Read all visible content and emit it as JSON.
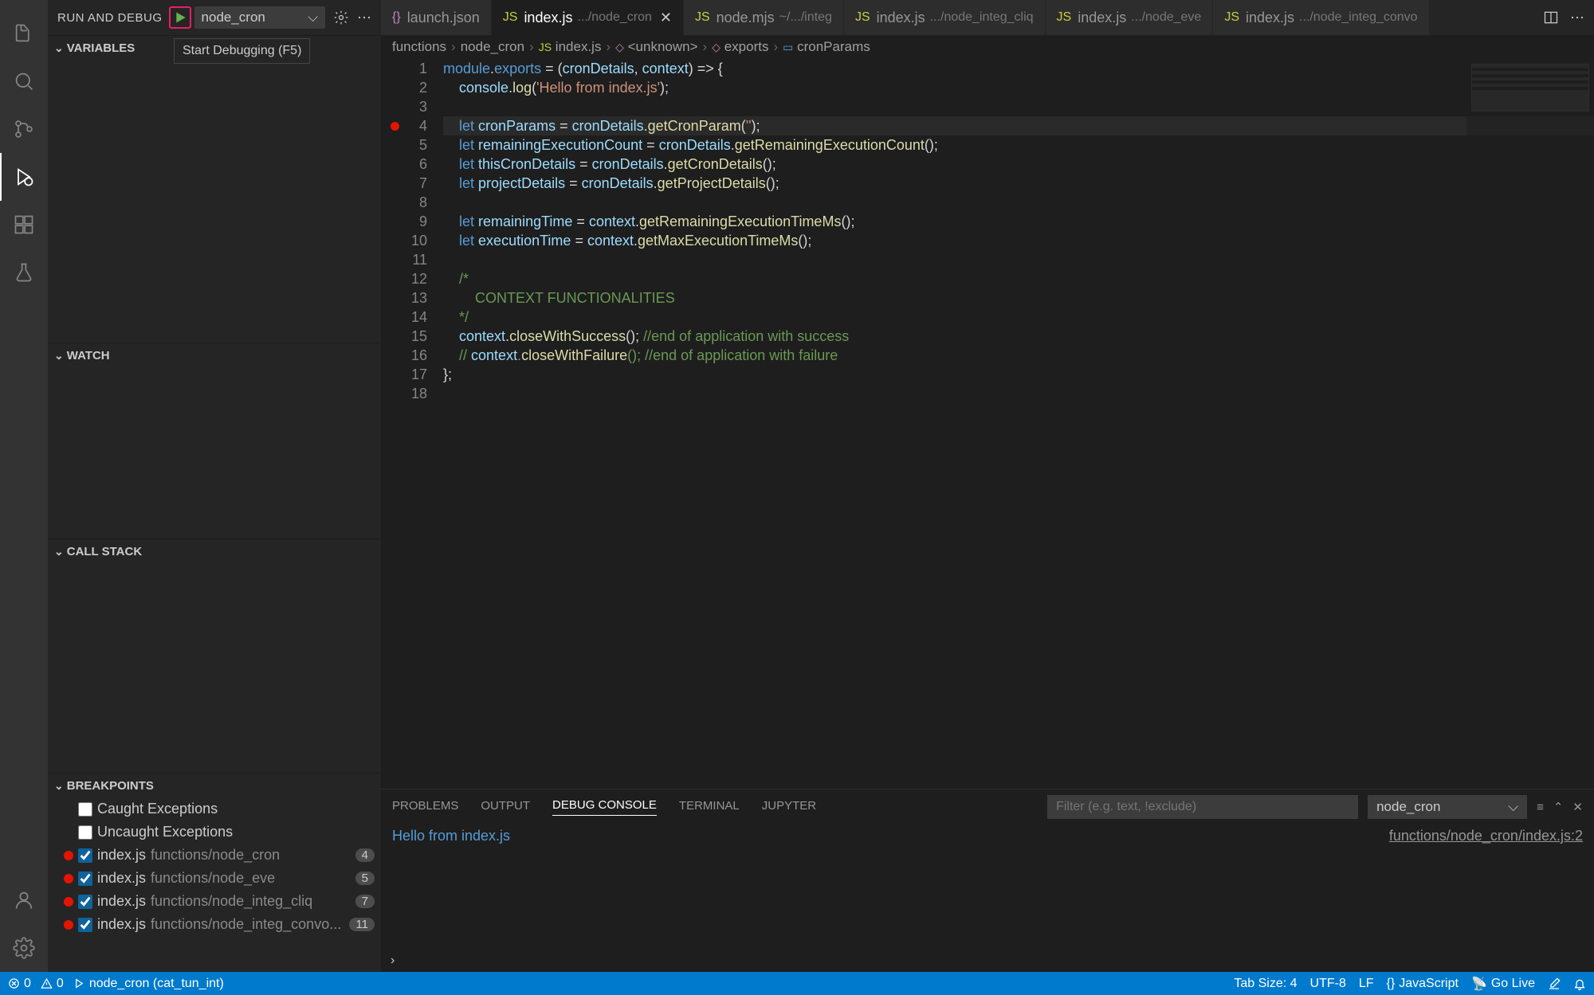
{
  "activityBar": {
    "icons": [
      "files",
      "search",
      "source-control",
      "run-debug",
      "extensions",
      "testing"
    ],
    "bottomIcons": [
      "account",
      "settings"
    ]
  },
  "sidebar": {
    "title": "RUN AND DEBUG",
    "config": "node_cron",
    "tooltip": "Start Debugging (F5)",
    "sections": {
      "variables": "VARIABLES",
      "watch": "WATCH",
      "callstack": "CALL STACK",
      "breakpoints": "BREAKPOINTS"
    },
    "exceptionBreakpoints": [
      {
        "label": "Caught Exceptions",
        "checked": false
      },
      {
        "label": "Uncaught Exceptions",
        "checked": false
      }
    ],
    "breakpointsList": [
      {
        "file": "index.js",
        "path": "functions/node_cron",
        "line": 4,
        "checked": true
      },
      {
        "file": "index.js",
        "path": "functions/node_eve",
        "line": 5,
        "checked": true
      },
      {
        "file": "index.js",
        "path": "functions/node_integ_cliq",
        "line": 7,
        "checked": true
      },
      {
        "file": "index.js",
        "path": "functions/node_integ_convo...",
        "line": 11,
        "checked": true
      }
    ]
  },
  "tabs": [
    {
      "icon": "{}",
      "iconColor": "#c586c0",
      "label": "launch.json",
      "sub": "",
      "active": false
    },
    {
      "icon": "JS",
      "iconColor": "#cbcb41",
      "label": "index.js",
      "sub": ".../node_cron",
      "active": true,
      "close": true
    },
    {
      "icon": "JS",
      "iconColor": "#cbcb41",
      "label": "node.mjs",
      "sub": "~/.../integ",
      "active": false
    },
    {
      "icon": "JS",
      "iconColor": "#cbcb41",
      "label": "index.js",
      "sub": ".../node_integ_cliq",
      "active": false
    },
    {
      "icon": "JS",
      "iconColor": "#cbcb41",
      "label": "index.js",
      "sub": ".../node_eve",
      "active": false
    },
    {
      "icon": "JS",
      "iconColor": "#cbcb41",
      "label": "index.js",
      "sub": ".../node_integ_convo",
      "active": false
    }
  ],
  "breadcrumb": [
    "functions",
    "node_cron",
    "index.js",
    "<unknown>",
    "exports",
    "cronParams"
  ],
  "code": {
    "lines": [
      "module.exports = (cronDetails, context) => {",
      "    console.log('Hello from index.js');",
      "",
      "    let cronParams = cronDetails.getCronParam('');",
      "    let remainingExecutionCount = cronDetails.getRemainingExecutionCount();",
      "    let thisCronDetails = cronDetails.getCronDetails();",
      "    let projectDetails = cronDetails.getProjectDetails();",
      "",
      "    let remainingTime = context.getRemainingExecutionTimeMs();",
      "    let executionTime = context.getMaxExecutionTimeMs();",
      "",
      "    /*",
      "        CONTEXT FUNCTIONALITIES",
      "    */",
      "    context.closeWithSuccess(); //end of application with success",
      "    // context.closeWithFailure(); //end of application with failure",
      "};",
      ""
    ],
    "breakpointLine": 4,
    "highlightLine": 4
  },
  "panel": {
    "tabs": [
      "PROBLEMS",
      "OUTPUT",
      "DEBUG CONSOLE",
      "TERMINAL",
      "JUPYTER"
    ],
    "activeTab": "DEBUG CONSOLE",
    "filterPlaceholder": "Filter (e.g. text, !exclude)",
    "session": "node_cron",
    "output": "Hello from index.js",
    "source": "functions/node_cron/index.js:2"
  },
  "statusBar": {
    "errors": 0,
    "warnings": 0,
    "debugTarget": "node_cron (cat_tun_int)",
    "tabSize": "Tab Size: 4",
    "encoding": "UTF-8",
    "eol": "LF",
    "language": "JavaScript",
    "goLive": "Go Live"
  }
}
